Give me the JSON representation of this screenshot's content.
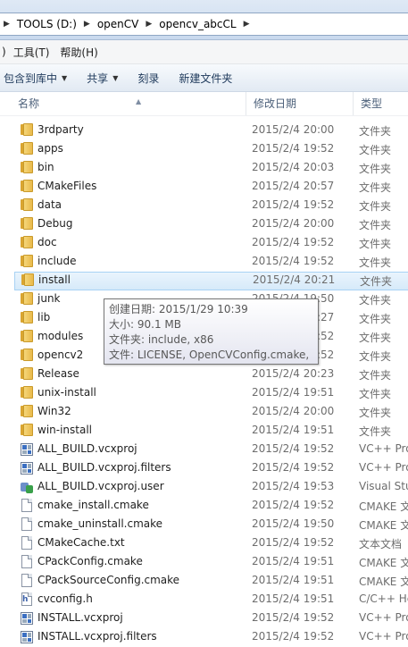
{
  "address": {
    "crumbs": [
      "TOOLS (D:)",
      "openCV",
      "opencv_abcCL"
    ]
  },
  "menu": [
    "工具(T)",
    "帮助(H)"
  ],
  "toolbar": {
    "include_in_library": "包含到库中",
    "share": "共享",
    "burn": "刻录",
    "new_folder": "新建文件夹"
  },
  "columns": {
    "name": "名称",
    "date": "修改日期",
    "type": "类型"
  },
  "files": [
    {
      "name": "3rdparty",
      "date": "2015/2/4 20:00",
      "type": "文件夹",
      "icon": "folder-icon"
    },
    {
      "name": "apps",
      "date": "2015/2/4 19:52",
      "type": "文件夹",
      "icon": "folder-icon"
    },
    {
      "name": "bin",
      "date": "2015/2/4 20:03",
      "type": "文件夹",
      "icon": "folder-icon"
    },
    {
      "name": "CMakeFiles",
      "date": "2015/2/4 20:57",
      "type": "文件夹",
      "icon": "folder-icon"
    },
    {
      "name": "data",
      "date": "2015/2/4 19:52",
      "type": "文件夹",
      "icon": "folder-icon"
    },
    {
      "name": "Debug",
      "date": "2015/2/4 20:00",
      "type": "文件夹",
      "icon": "folder-icon"
    },
    {
      "name": "doc",
      "date": "2015/2/4 19:52",
      "type": "文件夹",
      "icon": "folder-icon"
    },
    {
      "name": "include",
      "date": "2015/2/4 19:52",
      "type": "文件夹",
      "icon": "folder-icon"
    },
    {
      "name": "install",
      "date": "2015/2/4 20:21",
      "type": "文件夹",
      "icon": "folder-icon",
      "selected": true
    },
    {
      "name": "junk",
      "date": "2015/2/4 19:50",
      "type": "文件夹",
      "icon": "folder-icon"
    },
    {
      "name": "lib",
      "date": "2015/2/4 20:27",
      "type": "文件夹",
      "icon": "folder-icon"
    },
    {
      "name": "modules",
      "date": "2015/2/4 19:52",
      "type": "文件夹",
      "icon": "folder-icon"
    },
    {
      "name": "opencv2",
      "date": "2015/2/4 19:52",
      "type": "文件夹",
      "icon": "folder-icon"
    },
    {
      "name": "Release",
      "date": "2015/2/4 20:23",
      "type": "文件夹",
      "icon": "folder-icon"
    },
    {
      "name": "unix-install",
      "date": "2015/2/4 19:51",
      "type": "文件夹",
      "icon": "folder-icon"
    },
    {
      "name": "Win32",
      "date": "2015/2/4 20:00",
      "type": "文件夹",
      "icon": "folder-icon"
    },
    {
      "name": "win-install",
      "date": "2015/2/4 19:51",
      "type": "文件夹",
      "icon": "folder-icon"
    },
    {
      "name": "ALL_BUILD.vcxproj",
      "date": "2015/2/4 19:52",
      "type": "VC++ Pro",
      "icon": "vcxproj-icon"
    },
    {
      "name": "ALL_BUILD.vcxproj.filters",
      "date": "2015/2/4 19:52",
      "type": "VC++ Pro",
      "icon": "vcxproj-icon"
    },
    {
      "name": "ALL_BUILD.vcxproj.user",
      "date": "2015/2/4 19:53",
      "type": "Visual Stu",
      "icon": "vs-user-icon"
    },
    {
      "name": "cmake_install.cmake",
      "date": "2015/2/4 19:52",
      "type": "CMAKE 文",
      "icon": "file-icon"
    },
    {
      "name": "cmake_uninstall.cmake",
      "date": "2015/2/4 19:50",
      "type": "CMAKE 文",
      "icon": "file-icon"
    },
    {
      "name": "CMakeCache.txt",
      "date": "2015/2/4 19:52",
      "type": "文本文档",
      "icon": "text-file-icon"
    },
    {
      "name": "CPackConfig.cmake",
      "date": "2015/2/4 19:51",
      "type": "CMAKE 文",
      "icon": "file-icon"
    },
    {
      "name": "CPackSourceConfig.cmake",
      "date": "2015/2/4 19:51",
      "type": "CMAKE 文",
      "icon": "file-icon"
    },
    {
      "name": "cvconfig.h",
      "date": "2015/2/4 19:51",
      "type": "C/C++ He",
      "icon": "header-file-icon"
    },
    {
      "name": "INSTALL.vcxproj",
      "date": "2015/2/4 19:52",
      "type": "VC++ Pro",
      "icon": "vcxproj-icon"
    },
    {
      "name": "INSTALL.vcxproj.filters",
      "date": "2015/2/4 19:52",
      "type": "VC++ Pro",
      "icon": "vcxproj-icon"
    }
  ],
  "tooltip": {
    "created": "创建日期: 2015/1/29 10:39",
    "size": "大小: 90.1 MB",
    "folders": "文件夹: include, x86",
    "files": "文件: LICENSE, OpenCVConfig.cmake, ..."
  }
}
